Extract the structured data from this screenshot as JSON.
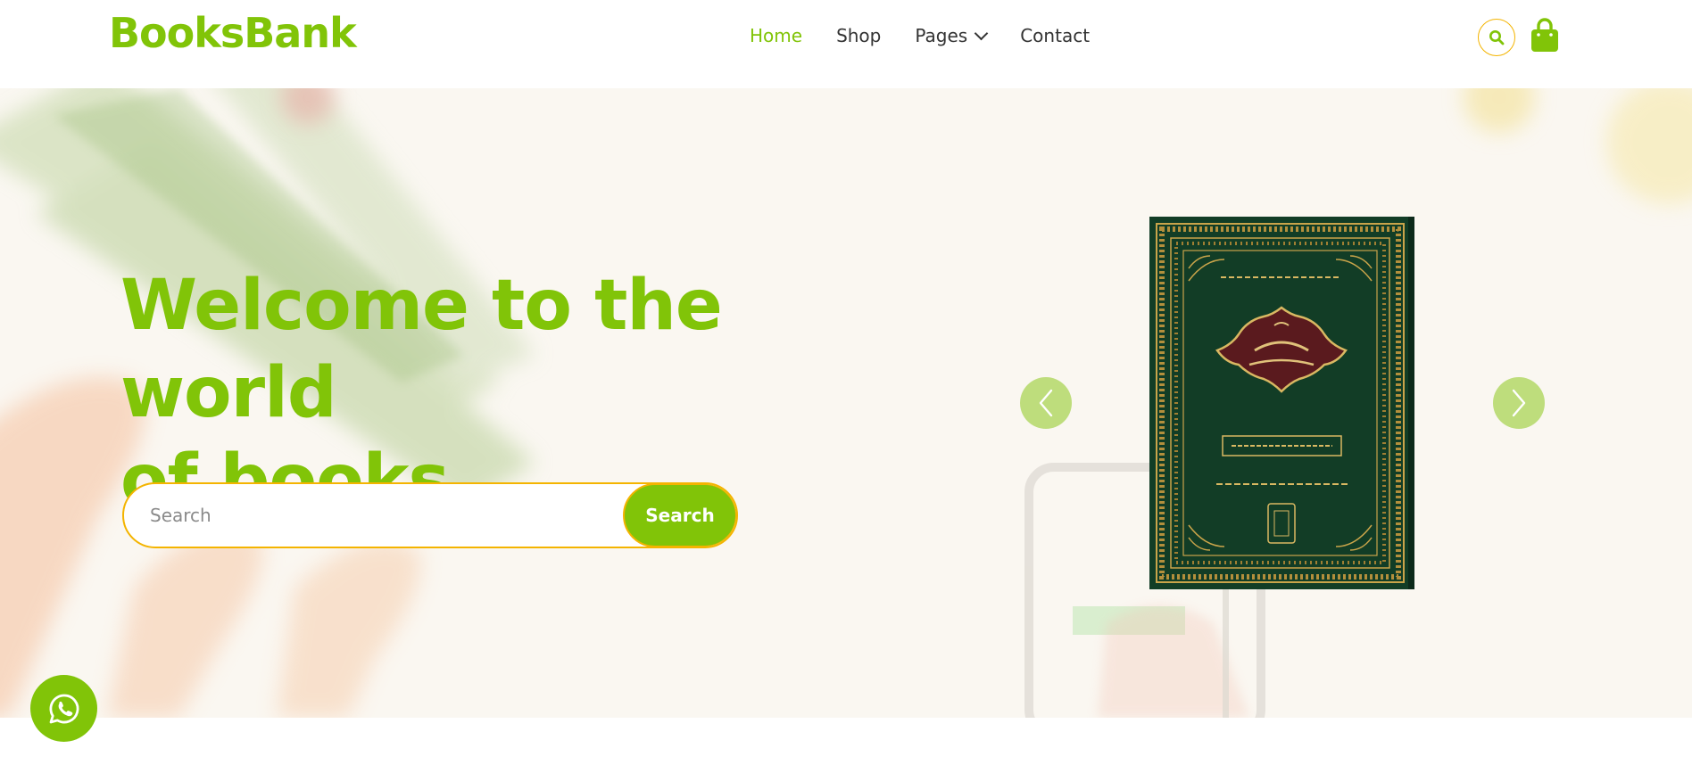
{
  "brand": {
    "name": "BooksBank"
  },
  "nav": {
    "items": [
      {
        "label": "Home",
        "active": true
      },
      {
        "label": "Shop",
        "active": false
      },
      {
        "label": "Pages",
        "active": false,
        "has_dropdown": true
      },
      {
        "label": "Contact",
        "active": false
      }
    ]
  },
  "hero": {
    "title_line1": "Welcome to the world",
    "title_line2": "of books.",
    "search": {
      "placeholder": "Search",
      "button_label": "Search"
    }
  },
  "icons": {
    "header_search": "search-icon",
    "cart": "shopping-bag-icon",
    "carousel_prev": "chevron-left-icon",
    "carousel_next": "chevron-right-icon",
    "floating_chat": "whatsapp-icon"
  },
  "colors": {
    "primary": "#81c408",
    "accent": "#f4b400",
    "text": "#333333",
    "hero_bg": "#faf7f1",
    "book_cover": "#123d26"
  }
}
